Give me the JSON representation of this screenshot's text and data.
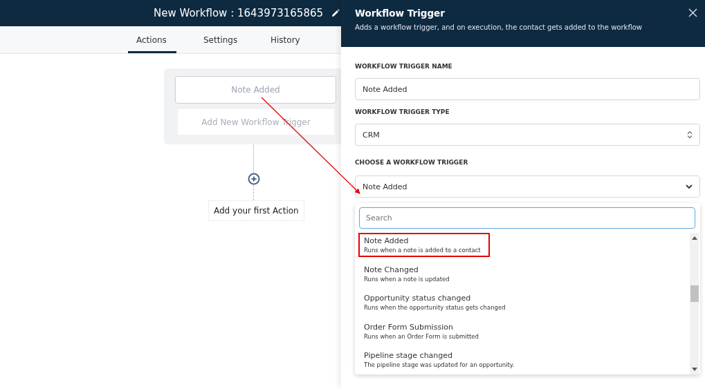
{
  "header": {
    "title": "New Workflow : 1643973165865"
  },
  "tabs": [
    {
      "label": "Actions",
      "selected": true
    },
    {
      "label": "Settings",
      "selected": false
    },
    {
      "label": "History",
      "selected": false
    }
  ],
  "canvas": {
    "triggers": [
      {
        "label": "Note Added",
        "kind": "trigger"
      },
      {
        "label": "Add New Workflow Trigger",
        "kind": "add"
      }
    ],
    "first_action": "Add your first Action"
  },
  "panel": {
    "title": "Workflow Trigger",
    "subtitle": "Adds a workflow trigger, and on execution, the contact gets added to the workflow",
    "name_label": "WORKFLOW TRIGGER NAME",
    "name_value": "Note Added",
    "type_label": "WORKFLOW TRIGGER TYPE",
    "type_value": "CRM",
    "choose_label": "CHOOSE A WORKFLOW TRIGGER",
    "choose_value": "Note Added",
    "search": {
      "placeholder": "Search"
    },
    "options": [
      {
        "title": "Note Added",
        "description": "Runs when a note is added to a contact",
        "annotated": true
      },
      {
        "title": "Note Changed",
        "description": "Runs when a note is updated",
        "annotated": false
      },
      {
        "title": "Opportunity status changed",
        "description": "Runs when the opportunity status gets changed",
        "annotated": false
      },
      {
        "title": "Order Form Submission",
        "description": "Runs when an Order Form is submitted",
        "annotated": false
      },
      {
        "title": "Pipeline stage changed",
        "description": "The pipeline stage was updated for an opportunity.",
        "annotated": false
      }
    ]
  }
}
